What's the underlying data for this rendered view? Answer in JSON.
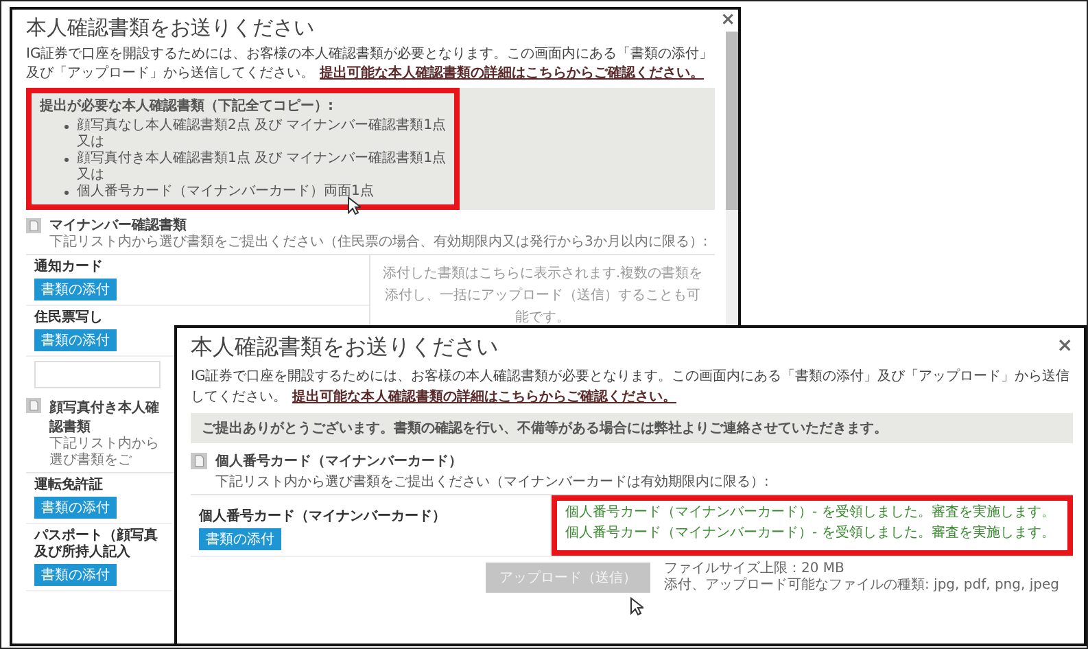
{
  "back_dialog": {
    "title": "本人確認書類をお送りください",
    "close": "×",
    "intro": "IG証券で口座を開設するためには、お客様の本人確認書類が必要となります。この画面内にある「書類の添付」及び「アップロード」から送信してください。",
    "link": "提出可能な本人確認書類の詳細はこちらからご確認ください。",
    "required_box": {
      "highlighted": true,
      "heading": "提出が必要な本人確認書類（下記全てコピー）:",
      "items": [
        {
          "text": "顔写真なし本人確認書類2点 及び マイナンバー確認書類1点",
          "note": "又は"
        },
        {
          "text": "顔写真付き本人確認書類1点 及び マイナンバー確認書類1点",
          "note": "又は"
        },
        {
          "text": "個人番号カード（マイナンバーカード）両面1点"
        }
      ]
    },
    "sections": [
      {
        "title": "マイナンバー確認書類",
        "instruction": "下記リスト内から選び書類をご提出ください（住民票の場合、有効期限内又は発行から3か月以内に限る）:",
        "pane_text": "添付した書類はこちらに表示されます.複数の書類を添付し、一括にアップロード（送信）することも可能です。",
        "rows": [
          {
            "label": "通知カード",
            "button": "書類の添付"
          },
          {
            "label": "住民票写し",
            "button": "書類の添付"
          }
        ]
      },
      {
        "title": "顔写真付き本人確認書類",
        "instruction": "下記リスト内から選び書類をご",
        "rows": [
          {
            "label": "運転免許証",
            "button": "書類の添付"
          },
          {
            "label": "パスポート（顔写真及び所持人記入",
            "button": "書類の添付"
          }
        ]
      }
    ]
  },
  "front_dialog": {
    "title": "本人確認書類をお送りください",
    "close": "×",
    "intro": "IG証券で口座を開設するためには、お客様の本人確認書類が必要となります。この画面内にある「書類の添付」及び「アップロード」から送信してください。",
    "link": "提出可能な本人確認書類の詳細はこちらからご確認ください。",
    "notice": "ご提出ありがとうございます。書類の確認を行い、不備等がある場合には弊社よりご連絡させていただきます。",
    "section": {
      "title": "個人番号カード（マイナンバーカード）",
      "instruction": "下記リスト内から選び書類をご提出ください（マイナンバーカードは有効期限内に限る）:",
      "rows": [
        {
          "label": "個人番号カード（マイナンバーカード）",
          "button": "書類の添付"
        }
      ]
    },
    "received": {
      "highlighted": true,
      "messages": [
        "個人番号カード（マイナンバーカード）- を受領しました。審査を実施します。",
        "個人番号カード（マイナンバーカード）- を受領しました。審査を実施します。"
      ]
    },
    "upload": {
      "button": "アップロード（送信）",
      "disabled": true,
      "limits": [
        "ファイルサイズ上限：20 MB",
        "添付、アップロード可能なファイルの種類: jpg, pdf, png, jpeg"
      ]
    }
  }
}
